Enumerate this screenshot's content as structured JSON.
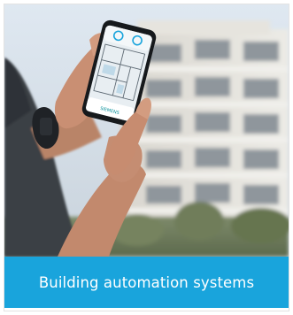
{
  "caption": {
    "text": "Building automation systems",
    "background": "#19a4dc",
    "color": "#ffffff"
  },
  "photo": {
    "subject": "hand-holding-smartphone-with-building-app",
    "background_subject": "modern-apartment-building"
  },
  "phone_screen": {
    "footer_text": "SIEMENS"
  }
}
